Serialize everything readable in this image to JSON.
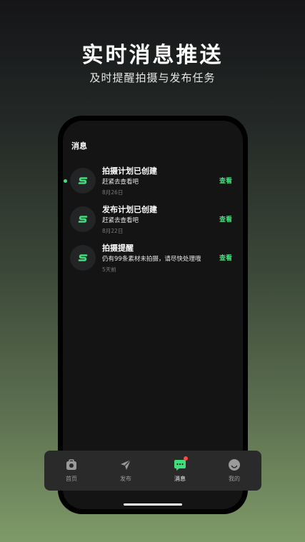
{
  "hero": {
    "title": "实时消息推送",
    "subtitle": "及时提醒拍摄与发布任务"
  },
  "screen": {
    "title": "消息"
  },
  "messages": [
    {
      "title": "拍摄计划已创建",
      "body": "赶紧去查看吧",
      "date": "8月26日",
      "action": "查看",
      "unread": true,
      "icon": "s-logo-icon"
    },
    {
      "title": "发布计划已创建",
      "body": "赶紧去查看吧",
      "date": "8月22日",
      "action": "查看",
      "unread": false,
      "icon": "s-logo-icon"
    },
    {
      "title": "拍摄提醒",
      "body": "仍有99条素材未拍摄，请尽快处理哦",
      "date": "5天前",
      "action": "查看",
      "unread": false,
      "icon": "s-logo-icon"
    }
  ],
  "tabbar": {
    "tabs": [
      {
        "label": "首页",
        "icon": "camera-bag-icon",
        "active": false
      },
      {
        "label": "发布",
        "icon": "send-icon",
        "active": false
      },
      {
        "label": "消息",
        "icon": "chat-bubble-icon",
        "active": true,
        "badge": true
      },
      {
        "label": "我的",
        "icon": "smiley-face-icon",
        "active": false
      }
    ]
  },
  "colors": {
    "accent": "#3ee07c",
    "badge": "#ff4a3d",
    "screen_bg": "#141414",
    "tabbar_bg": "#2a2a2a"
  }
}
